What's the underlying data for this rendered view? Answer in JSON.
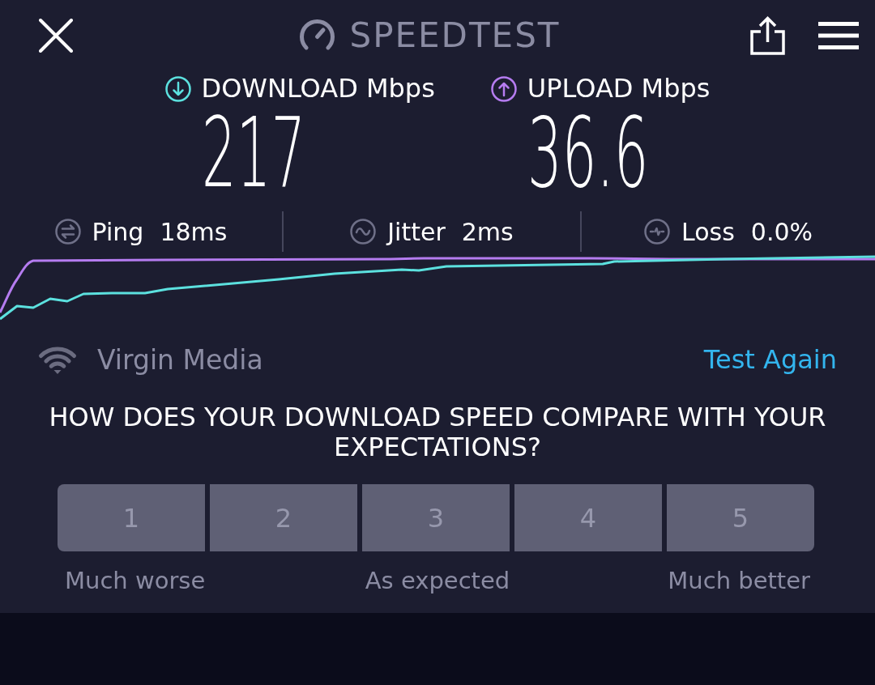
{
  "header": {
    "title": "SPEEDTEST"
  },
  "speeds": [
    {
      "kind": "download",
      "label": "DOWNLOAD Mbps",
      "value": "217",
      "color": "#5ce1df"
    },
    {
      "kind": "upload",
      "label": "UPLOAD Mbps",
      "value": "36.6",
      "color": "#b57cf0"
    }
  ],
  "metrics": [
    {
      "kind": "ping",
      "label": "Ping",
      "value": "18ms"
    },
    {
      "kind": "jitter",
      "label": "Jitter",
      "value": "2ms"
    },
    {
      "kind": "loss",
      "label": "Loss",
      "value": "0.0%"
    }
  ],
  "connection": {
    "provider": "Virgin Media",
    "action": "Test Again"
  },
  "survey": {
    "question": "HOW DOES YOUR DOWNLOAD SPEED COMPARE WITH YOUR EXPECTATIONS?",
    "options": [
      {
        "label": "1",
        "selected": false
      },
      {
        "label": "2",
        "selected": false
      },
      {
        "label": "3",
        "selected": false
      },
      {
        "label": "4",
        "selected": false
      },
      {
        "label": "5",
        "selected": false
      }
    ],
    "scale_labels": [
      "Much worse",
      "As expected",
      "Much better"
    ]
  }
}
